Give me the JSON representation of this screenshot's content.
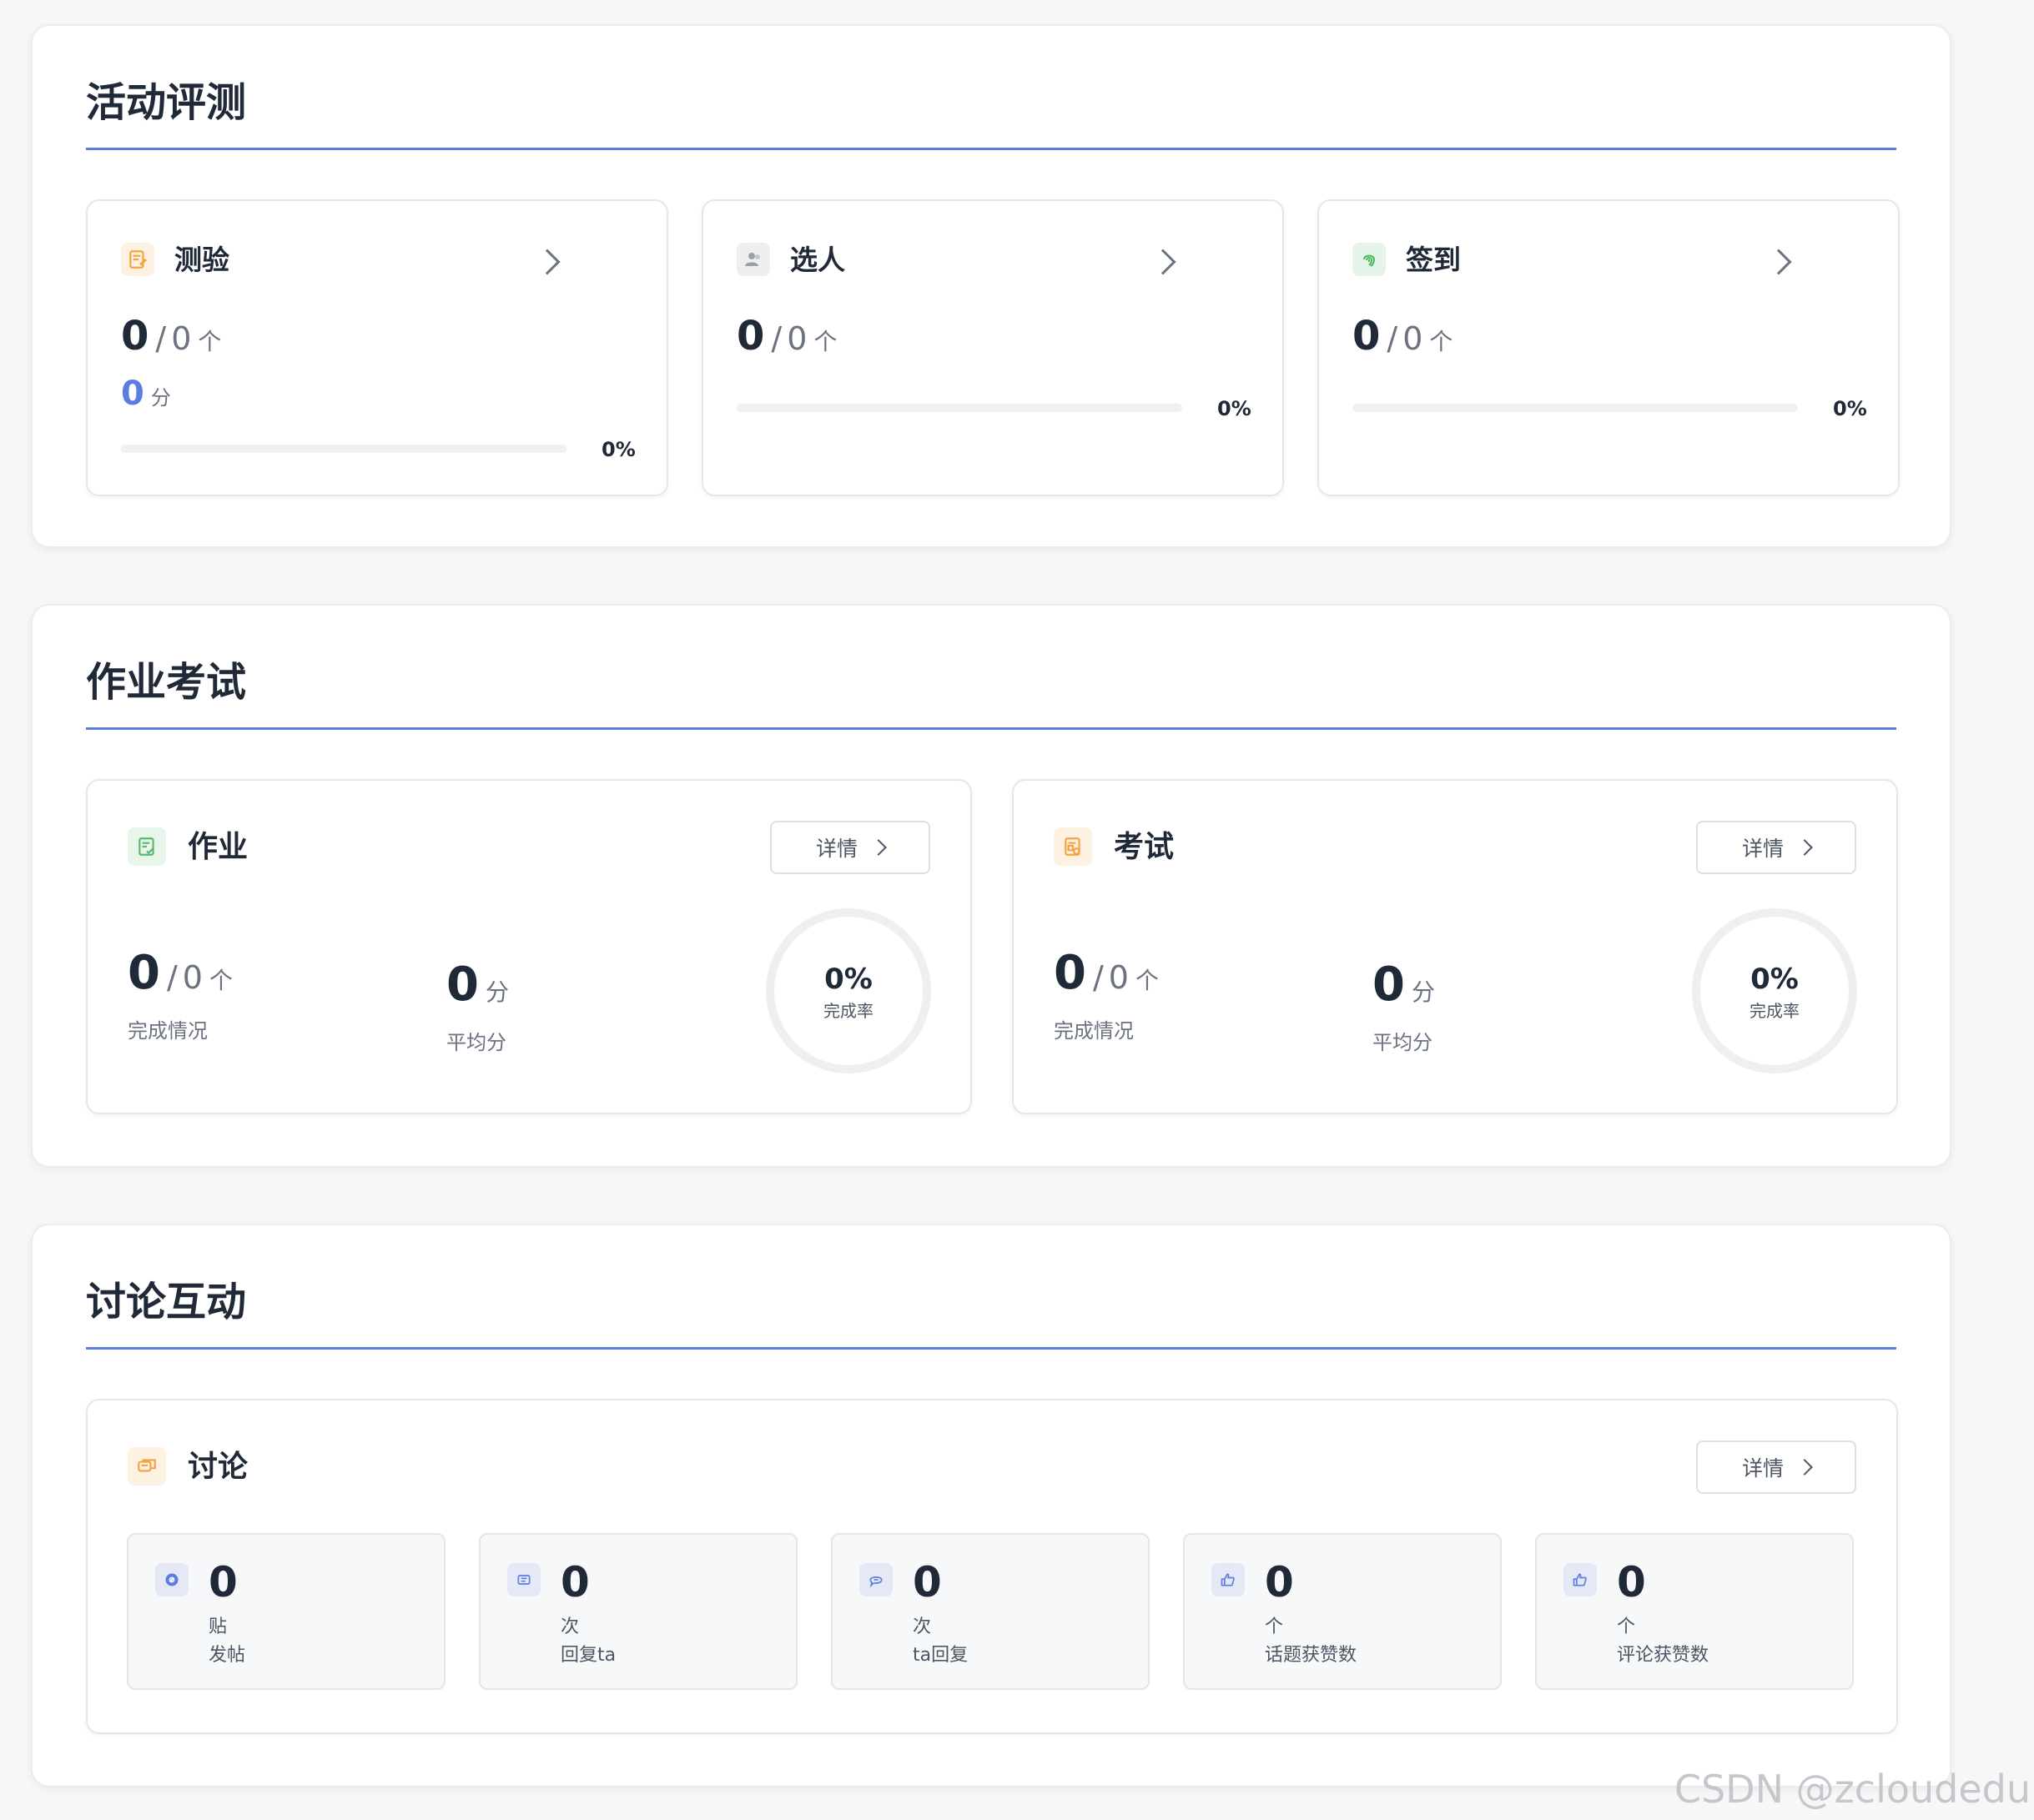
{
  "sections": {
    "activity": {
      "title": "活动评测",
      "cards": [
        {
          "title": "测验",
          "done": "0",
          "slash": "/",
          "total": "0",
          "unit": "个",
          "score": "0",
          "score_unit": "分",
          "percent": "0%",
          "progress": 0,
          "icon": "quiz-icon",
          "color": "#f4a340"
        },
        {
          "title": "选人",
          "done": "0",
          "slash": "/",
          "total": "0",
          "unit": "个",
          "percent": "0%",
          "progress": 0,
          "icon": "person-icon",
          "color": "#9aa0a8"
        },
        {
          "title": "签到",
          "done": "0",
          "slash": "/",
          "total": "0",
          "unit": "个",
          "percent": "0%",
          "progress": 0,
          "icon": "fingerprint-icon",
          "color": "#4cb85c"
        }
      ]
    },
    "homework_exam": {
      "title": "作业考试",
      "cards": [
        {
          "title": "作业",
          "detail": "详情",
          "done": "0",
          "slash": "/",
          "total": "0",
          "unit": "个",
          "done_caption": "完成情况",
          "avg": "0",
          "avg_unit": "分",
          "avg_caption": "平均分",
          "rate": "0%",
          "rate_caption": "完成率",
          "icon": "homework-icon",
          "color": "#59b86b"
        },
        {
          "title": "考试",
          "detail": "详情",
          "done": "0",
          "slash": "/",
          "total": "0",
          "unit": "个",
          "done_caption": "完成情况",
          "avg": "0",
          "avg_unit": "分",
          "avg_caption": "平均分",
          "rate": "0%",
          "rate_caption": "完成率",
          "icon": "exam-icon",
          "color": "#f4a340"
        }
      ]
    },
    "discussion": {
      "title": "讨论互动",
      "card": {
        "title": "讨论",
        "detail": "详情",
        "icon": "discussion-icon",
        "color": "#f4a340",
        "stats": [
          {
            "value": "0",
            "unit": "贴",
            "label": "发帖",
            "icon": "post-icon"
          },
          {
            "value": "0",
            "unit": "次",
            "label": "回复ta",
            "icon": "reply-to-icon"
          },
          {
            "value": "0",
            "unit": "次",
            "label": "ta回复",
            "icon": "reply-from-icon"
          },
          {
            "value": "0",
            "unit": "个",
            "label": "话题获赞数",
            "icon": "thumbs-up-icon"
          },
          {
            "value": "0",
            "unit": "个",
            "label": "评论获赞数",
            "icon": "thumbs-up-icon"
          }
        ]
      }
    }
  },
  "watermark": "CSDN @zcloudedu",
  "colors": {
    "accent": "#5b7de0",
    "text": "#1f2937",
    "muted": "#6b7280"
  }
}
